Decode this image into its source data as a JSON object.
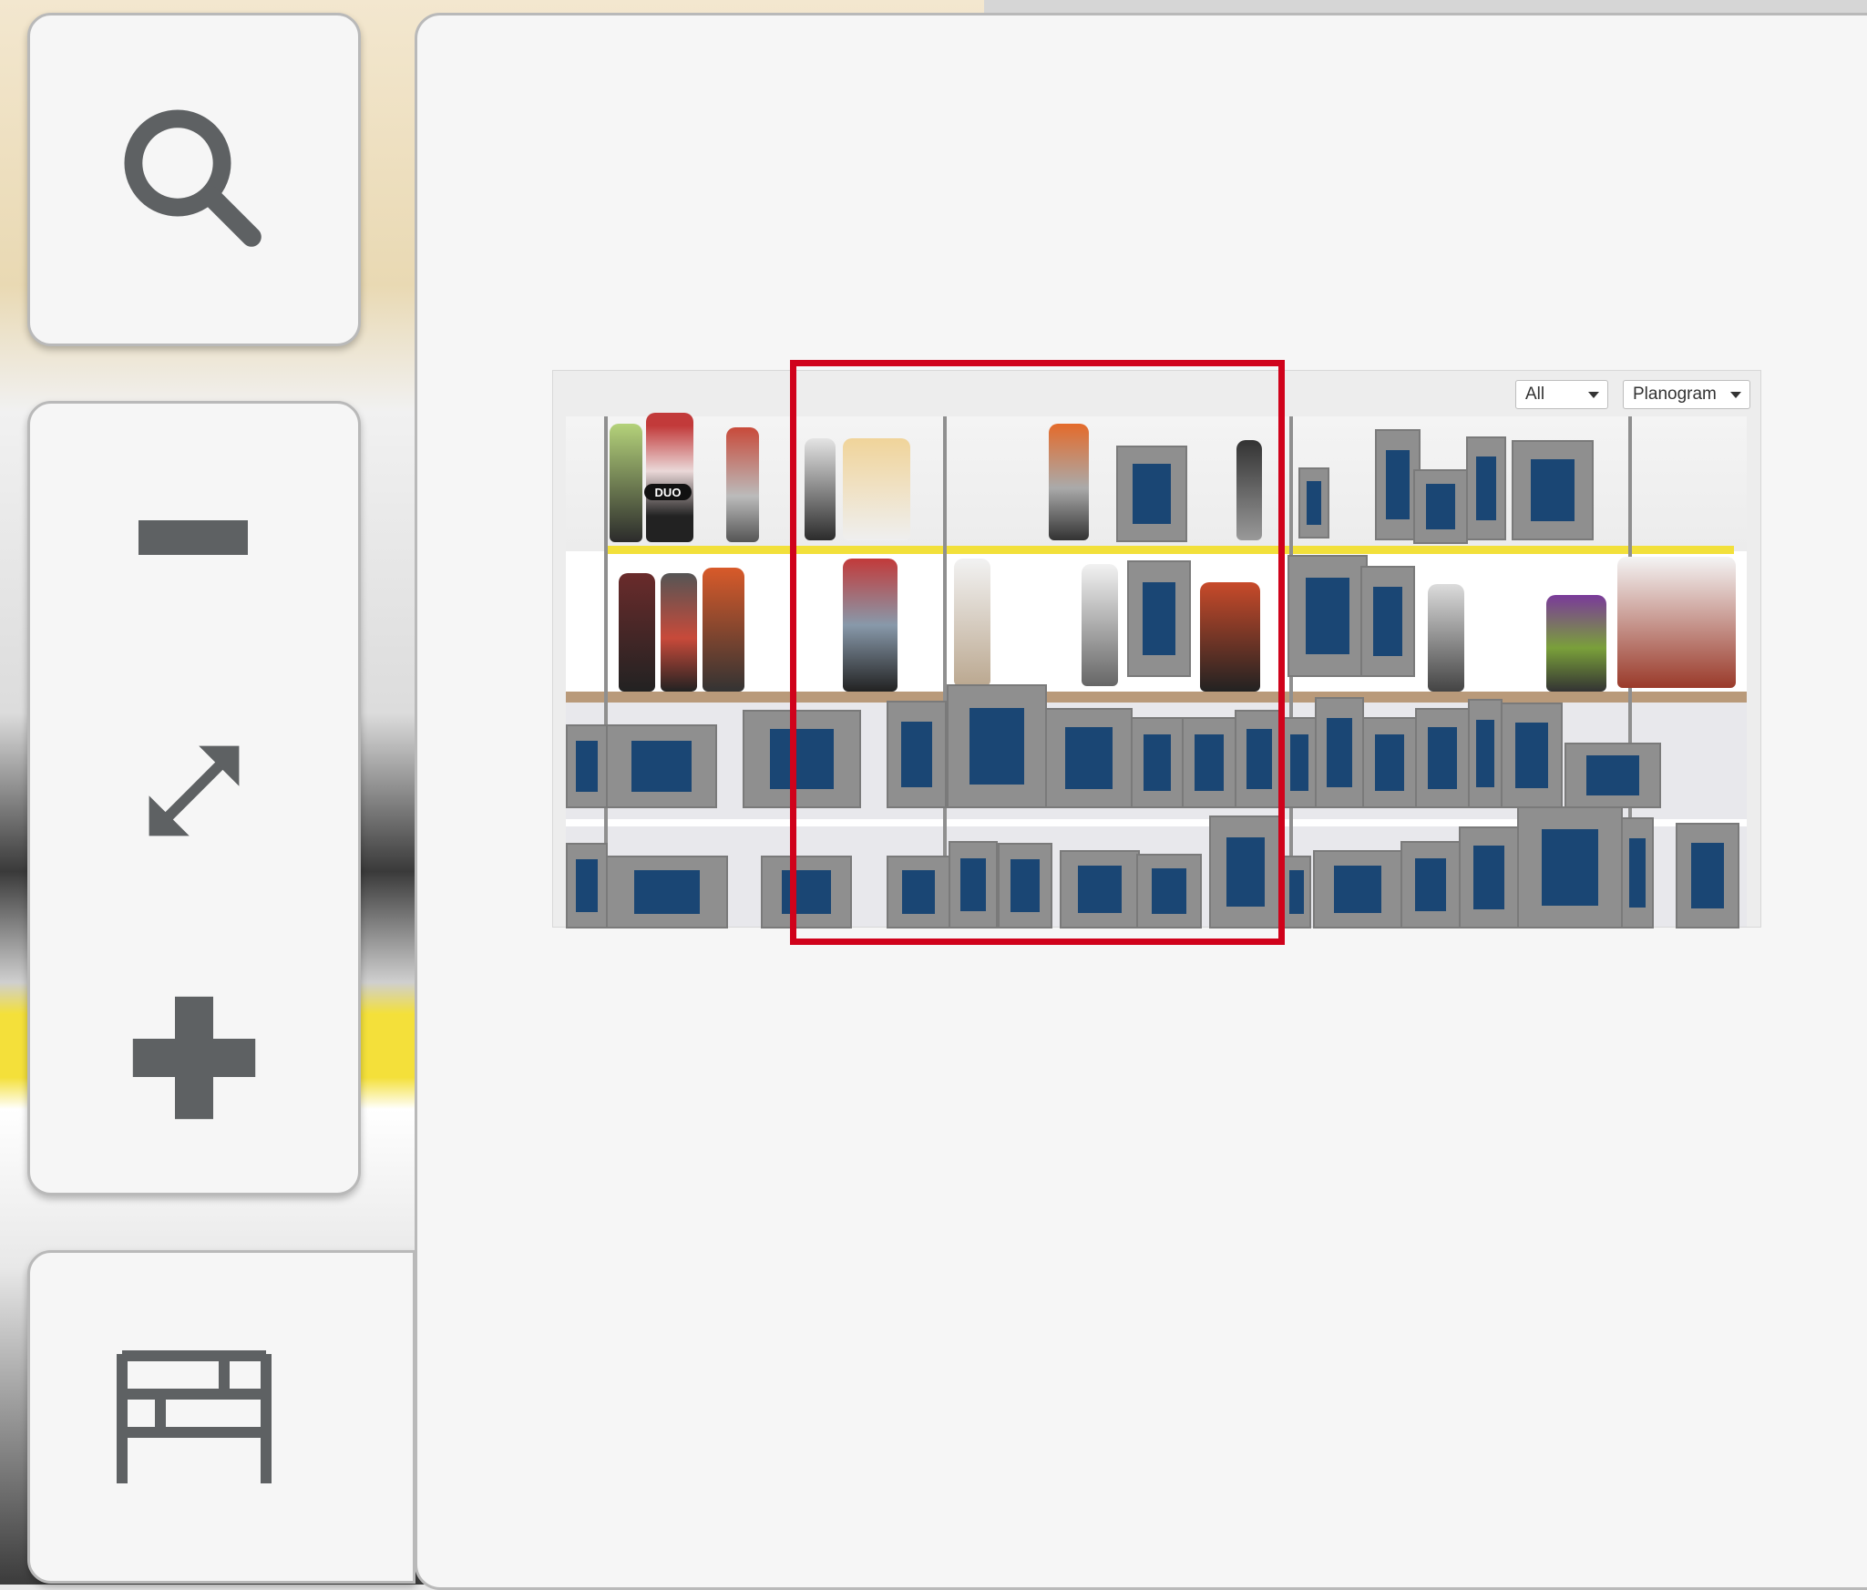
{
  "toolbar": {
    "search_icon": "search-icon",
    "zoom_out_icon": "minus-icon",
    "fit_icon": "expand-arrows-icon",
    "zoom_in_icon": "plus-icon",
    "planogram_icon": "shelf-icon"
  },
  "overview": {
    "filter_dropdown": {
      "selected": "All"
    },
    "view_dropdown": {
      "selected": "Planogram"
    },
    "shelf_label_badge": "DUO"
  },
  "colors": {
    "viewport_border": "#d0021b",
    "product_placeholder_fill": "#1a4674",
    "product_placeholder_frame": "#8f8f8f",
    "shelf_accent": "#f2e03a",
    "icon_gray": "#5e6163"
  }
}
